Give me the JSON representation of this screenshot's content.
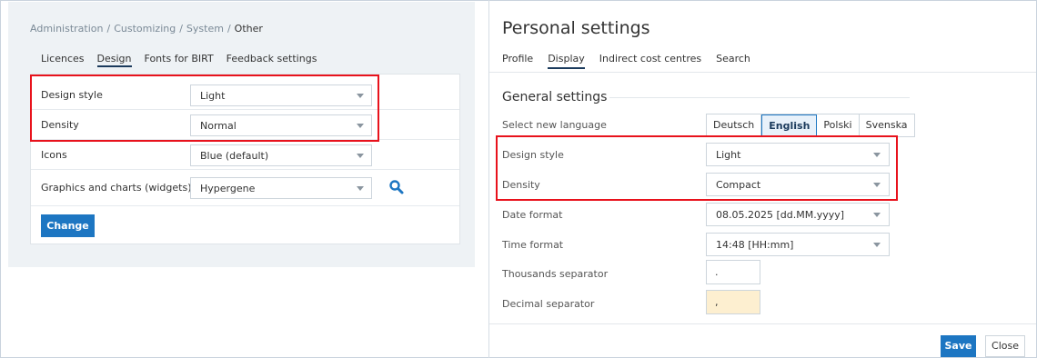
{
  "breadcrumb": {
    "items": [
      "Administration",
      "Customizing",
      "System"
    ],
    "current": "Other",
    "separator": "/"
  },
  "left_tabs": [
    {
      "label": "Licences",
      "active": false
    },
    {
      "label": "Design",
      "active": true
    },
    {
      "label": "Fonts for BIRT",
      "active": false
    },
    {
      "label": "Feedback settings",
      "active": false
    }
  ],
  "design_form": {
    "rows": [
      {
        "label": "Design style",
        "value": "Light"
      },
      {
        "label": "Density",
        "value": "Normal"
      },
      {
        "label": "Icons",
        "value": "Blue (default)"
      },
      {
        "label": "Graphics and charts (widgets)",
        "value": "Hypergene"
      }
    ],
    "change_label": "Change",
    "search_icon": "magnifier-icon"
  },
  "personal_settings": {
    "title": "Personal settings",
    "tabs": [
      {
        "label": "Profile",
        "active": false
      },
      {
        "label": "Display",
        "active": true
      },
      {
        "label": "Indirect cost centres",
        "active": false
      },
      {
        "label": "Search",
        "active": false
      }
    ],
    "section_title": "General settings",
    "language": {
      "label": "Select new language",
      "options": [
        "Deutsch",
        "English",
        "Polski",
        "Svenska"
      ],
      "selected": "English"
    },
    "design_style": {
      "label": "Design style",
      "value": "Light"
    },
    "density": {
      "label": "Density",
      "value": "Compact"
    },
    "date_format": {
      "label": "Date format",
      "value": "08.05.2025 [dd.MM.yyyy]"
    },
    "time_format": {
      "label": "Time format",
      "value": "14:48 [HH:mm]"
    },
    "thousands_separator": {
      "label": "Thousands separator",
      "value": "."
    },
    "decimal_separator": {
      "label": "Decimal separator",
      "value": ","
    },
    "save_label": "Save",
    "close_label": "Close"
  },
  "colors": {
    "accent": "#1d76c2",
    "highlight_box": "#e8121c",
    "decimal_field_bg": "#fdefd0"
  }
}
